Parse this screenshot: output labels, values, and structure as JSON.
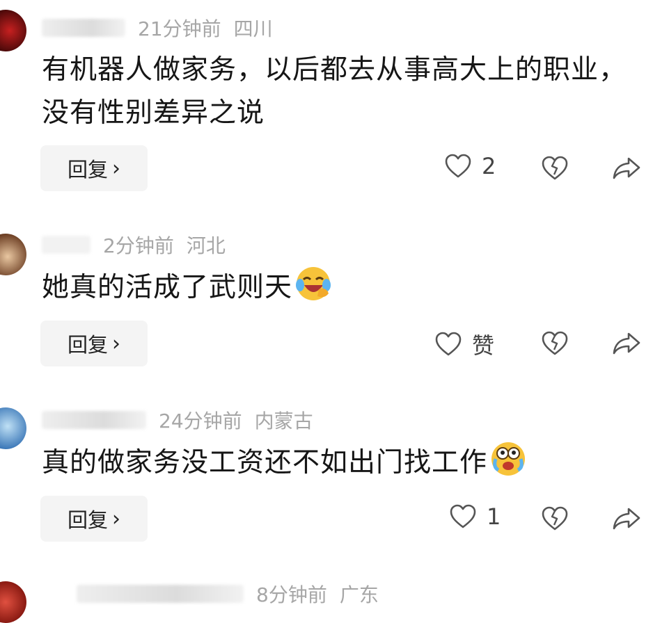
{
  "comments": [
    {
      "time": "21分钟前",
      "location": "四川",
      "text": "有机器人做家务，以后都去从事高大上的职业，没有性别差异之说",
      "reply_label": "回复",
      "like_label": "2",
      "emoji": null,
      "avatar_color": "#7a1010"
    },
    {
      "time": "2分钟前",
      "location": "河北",
      "text": "她真的活成了武则天",
      "reply_label": "回复",
      "like_label": "赞",
      "emoji": "laughing-tears-emoji",
      "avatar_color": "#8a5a3a"
    },
    {
      "time": "24分钟前",
      "location": "内蒙古",
      "text": "真的做家务没工资还不如出门找工作",
      "reply_label": "回复",
      "like_label": "1",
      "emoji": "crying-emoji",
      "avatar_color": "#6a9ccc"
    },
    {
      "time": "8分钟前",
      "location": "广东",
      "avatar_color": "#c0392b"
    }
  ]
}
